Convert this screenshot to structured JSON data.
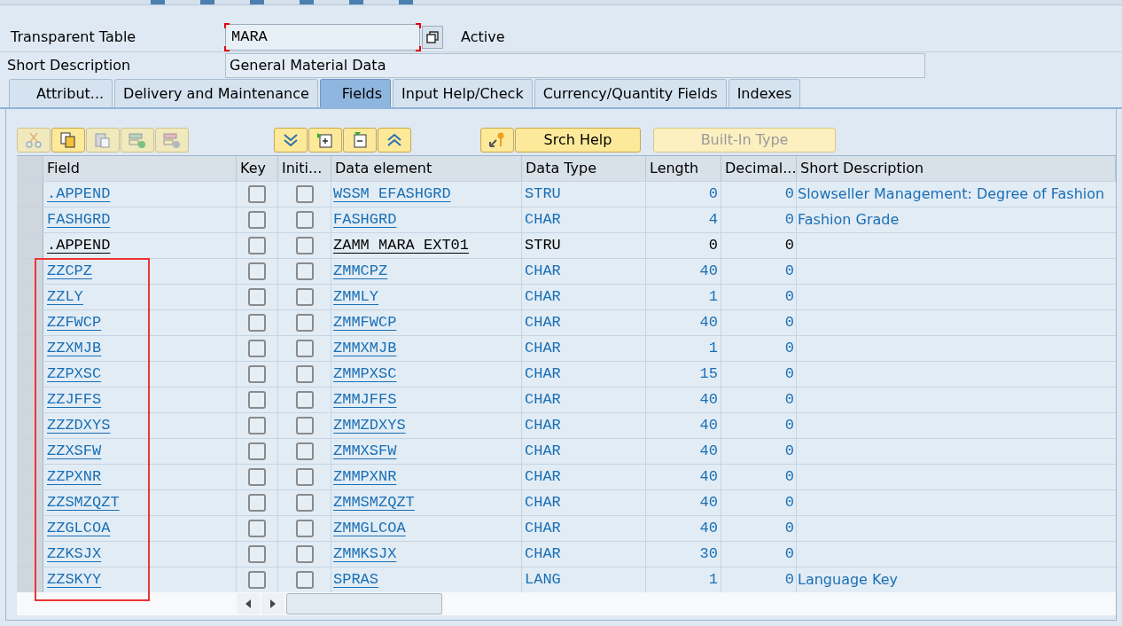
{
  "header": {
    "table_label": "Transparent Table",
    "table_name": "MARA",
    "status": "Active",
    "description_label": "Short Description",
    "description": "General Material Data"
  },
  "tabs": [
    {
      "label": "Attribut...",
      "selected": false
    },
    {
      "label": "Delivery and Maintenance",
      "selected": false
    },
    {
      "label": "Fields",
      "selected": true
    },
    {
      "label": "Input Help/Check",
      "selected": false
    },
    {
      "label": "Currency/Quantity Fields",
      "selected": false
    },
    {
      "label": "Indexes",
      "selected": false
    }
  ],
  "toolbar": [
    {
      "label": "Srch Help",
      "disabled": false
    },
    {
      "label": "Built-In Type",
      "disabled": true
    }
  ],
  "table": {
    "columns": [
      "Field",
      "Key",
      "Initi...",
      "Data element",
      "Data Type",
      "Length",
      "Decimal...",
      "Short Description"
    ],
    "rows": [
      {
        "field": ".APPEND",
        "key": false,
        "initial": false,
        "data_element": "WSSM EFASHGRD",
        "data_type": "STRU",
        "length": "0",
        "decimals": "0",
        "description": "Slowseller Management: Degree of Fashion",
        "kind": "link",
        "marked": false
      },
      {
        "field": "FASHGRD",
        "key": false,
        "initial": false,
        "data_element": "FASHGRD",
        "data_type": "CHAR",
        "length": "4",
        "decimals": "0",
        "description": "Fashion Grade",
        "kind": "link",
        "marked": false
      },
      {
        "field": ".APPEND",
        "key": false,
        "initial": false,
        "data_element": "ZAMM MARA EXT01",
        "data_type": "STRU",
        "length": "0",
        "decimals": "0",
        "kind": "plain",
        "marked": false
      },
      {
        "field": "ZZCPZ",
        "key": false,
        "initial": false,
        "data_element": "ZMMCPZ",
        "data_type": "CHAR",
        "length": "40",
        "decimals": "0",
        "kind": "link",
        "marked": true
      },
      {
        "field": "ZZLY",
        "key": false,
        "initial": false,
        "data_element": "ZMMLY",
        "data_type": "CHAR",
        "length": "1",
        "decimals": "0",
        "kind": "link",
        "marked": true
      },
      {
        "field": "ZZFWCP",
        "key": false,
        "initial": false,
        "data_element": "ZMMFWCP",
        "data_type": "CHAR",
        "length": "40",
        "decimals": "0",
        "kind": "link",
        "marked": true
      },
      {
        "field": "ZZXMJB",
        "key": false,
        "initial": false,
        "data_element": "ZMMXMJB",
        "data_type": "CHAR",
        "length": "1",
        "decimals": "0",
        "kind": "link",
        "marked": true
      },
      {
        "field": "ZZPXSC",
        "key": false,
        "initial": false,
        "data_element": "ZMMPXSC",
        "data_type": "CHAR",
        "length": "15",
        "decimals": "0",
        "kind": "link",
        "marked": true
      },
      {
        "field": "ZZJFFS",
        "key": false,
        "initial": false,
        "data_element": "ZMMJFFS",
        "data_type": "CHAR",
        "length": "40",
        "decimals": "0",
        "kind": "link",
        "marked": true
      },
      {
        "field": "ZZZDXYS",
        "key": false,
        "initial": false,
        "data_element": "ZMMZDXYS",
        "data_type": "CHAR",
        "length": "40",
        "decimals": "0",
        "kind": "link",
        "marked": true
      },
      {
        "field": "ZZXSFW",
        "key": false,
        "initial": false,
        "data_element": "ZMMXSFW",
        "data_type": "CHAR",
        "length": "40",
        "decimals": "0",
        "kind": "link",
        "marked": true
      },
      {
        "field": "ZZPXNR",
        "key": false,
        "initial": false,
        "data_element": "ZMMPXNR",
        "data_type": "CHAR",
        "length": "40",
        "decimals": "0",
        "kind": "link",
        "marked": true
      },
      {
        "field": "ZZSMZQZT",
        "key": false,
        "initial": false,
        "data_element": "ZMMSMZQZT",
        "data_type": "CHAR",
        "length": "40",
        "decimals": "0",
        "kind": "link",
        "marked": true
      },
      {
        "field": "ZZGLCOA",
        "key": false,
        "initial": false,
        "data_element": "ZMMGLCOA",
        "data_type": "CHAR",
        "length": "40",
        "decimals": "0",
        "kind": "link",
        "marked": true
      },
      {
        "field": "ZZKSJX",
        "key": false,
        "initial": false,
        "data_element": "ZMMKSJX",
        "data_type": "CHAR",
        "length": "30",
        "decimals": "0",
        "kind": "link",
        "marked": true
      },
      {
        "field": "ZZSKYY",
        "key": false,
        "initial": false,
        "data_element": "SPRAS",
        "data_type": "LANG",
        "length": "1",
        "decimals": "0",
        "description": "Language Key",
        "kind": "link",
        "marked": true
      }
    ]
  }
}
